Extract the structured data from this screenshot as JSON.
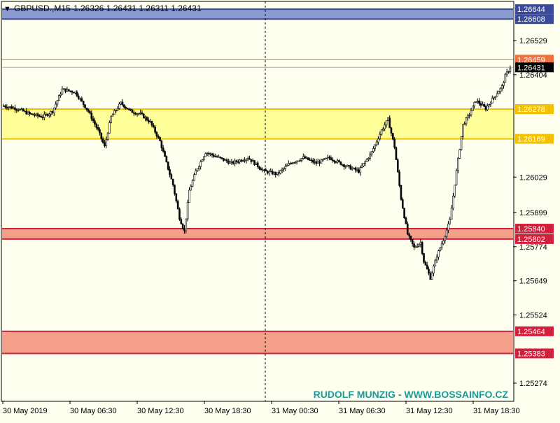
{
  "header": {
    "symbol_timeframe": "GBPUSD.,M15",
    "ohlc": "1.26326 1.26431 1.26311 1.26431"
  },
  "watermark": "RUDOLF MUNZIG - WWW.BOSSAINFO.CZ",
  "colors": {
    "background": "#fffff0",
    "candle": "#000000",
    "zone_blue": "#8a9bd1",
    "zone_yellow": "#ffff99",
    "zone_yellow_line": "#f2c200",
    "zone_red": "#f4a08a",
    "zone_red_line": "#d21f3c",
    "price_line": "#f07040",
    "watermark": "#1a9a9a"
  },
  "chart_data": {
    "type": "candlestick",
    "title": "GBPUSD.,M15",
    "ylim": [
      1.2521,
      1.2667
    ],
    "price_ticks": [
      "1.26529",
      "1.26404",
      "1.26029",
      "1.25899",
      "1.25774",
      "1.25649",
      "1.25524",
      "1.25274"
    ],
    "time_labels": [
      "30 May 2019",
      "30 May 06:30",
      "30 May 12:30",
      "30 May 18:30",
      "31 May 00:30",
      "31 May 06:30",
      "31 May 12:30",
      "31 May 18:30"
    ],
    "last_price": {
      "label": "1.26431",
      "value": 1.26431
    },
    "marked_levels": [
      {
        "label": "1.26459",
        "value": 1.26459,
        "style": "line"
      }
    ],
    "zones": [
      {
        "name": "blue",
        "top": 1.26644,
        "bottom": 1.26608,
        "top_label": "1.26644",
        "bottom_label": "1.26608"
      },
      {
        "name": "yellow",
        "top": 1.26278,
        "bottom": 1.26169,
        "top_label": "1.26278",
        "bottom_label": "1.26169"
      },
      {
        "name": "red-upper",
        "top": 1.2584,
        "bottom": 1.25802,
        "top_label": "1.25840",
        "bottom_label": "1.25802"
      },
      {
        "name": "red-lower",
        "top": 1.25464,
        "bottom": 1.25383,
        "top_label": "1.25464",
        "bottom_label": "1.25383"
      }
    ],
    "close_path": [
      [
        0,
        1.2629
      ],
      [
        8,
        1.2628
      ],
      [
        16,
        1.2626
      ],
      [
        24,
        1.2625
      ],
      [
        30,
        1.2627
      ],
      [
        36,
        1.2635
      ],
      [
        44,
        1.2634
      ],
      [
        52,
        1.2627
      ],
      [
        58,
        1.262
      ],
      [
        62,
        1.2614
      ],
      [
        66,
        1.2625
      ],
      [
        72,
        1.263
      ],
      [
        78,
        1.2627
      ],
      [
        84,
        1.2626
      ],
      [
        90,
        1.2623
      ],
      [
        96,
        1.2616
      ],
      [
        100,
        1.2608
      ],
      [
        104,
        1.26
      ],
      [
        108,
        1.2588
      ],
      [
        111,
        1.2583
      ],
      [
        114,
        1.2598
      ],
      [
        118,
        1.2605
      ],
      [
        124,
        1.2612
      ],
      [
        132,
        1.261
      ],
      [
        140,
        1.2608
      ],
      [
        150,
        1.261
      ],
      [
        160,
        1.2605
      ],
      [
        168,
        1.2604
      ],
      [
        176,
        1.2608
      ],
      [
        184,
        1.261
      ],
      [
        192,
        1.2608
      ],
      [
        200,
        1.261
      ],
      [
        210,
        1.2607
      ],
      [
        218,
        1.2605
      ],
      [
        226,
        1.2612
      ],
      [
        232,
        1.262
      ],
      [
        236,
        1.2624
      ],
      [
        240,
        1.2614
      ],
      [
        244,
        1.2595
      ],
      [
        248,
        1.2582
      ],
      [
        252,
        1.2577
      ],
      [
        256,
        1.2579
      ],
      [
        258,
        1.2572
      ],
      [
        262,
        1.2566
      ],
      [
        266,
        1.2574
      ],
      [
        270,
        1.258
      ],
      [
        274,
        1.2587
      ],
      [
        278,
        1.2605
      ],
      [
        282,
        1.2622
      ],
      [
        286,
        1.2626
      ],
      [
        290,
        1.2631
      ],
      [
        296,
        1.2628
      ],
      [
        302,
        1.2633
      ],
      [
        306,
        1.2636
      ],
      [
        308,
        1.264
      ],
      [
        311,
        1.2643
      ]
    ]
  }
}
